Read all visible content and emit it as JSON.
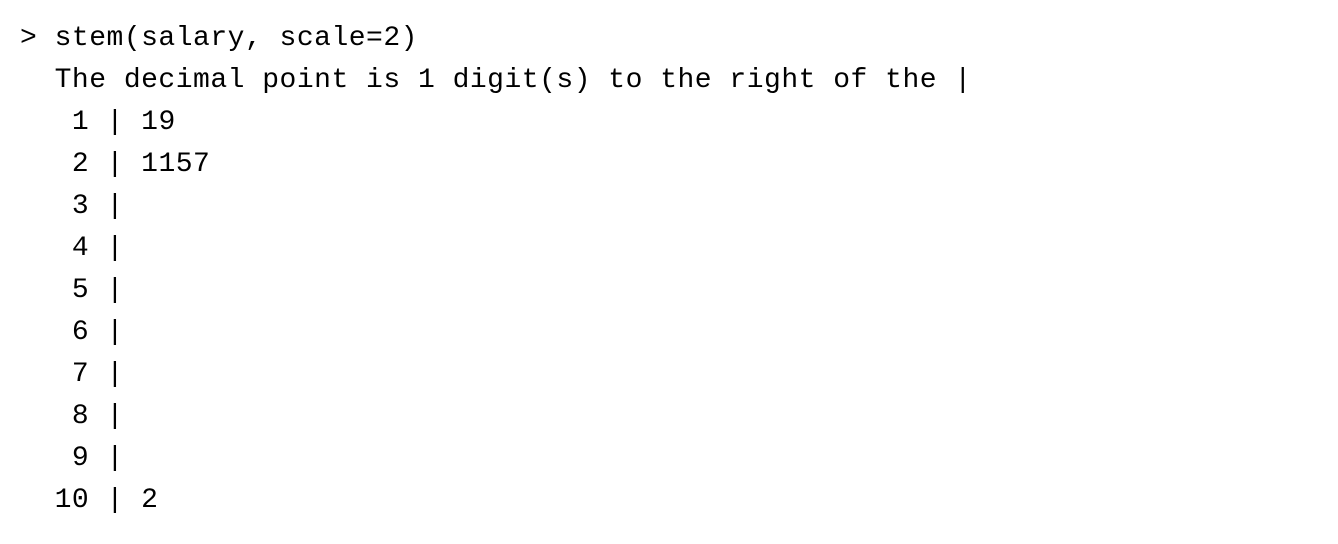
{
  "console": {
    "prompt": "> ",
    "command": "stem(salary, scale=2)",
    "info_indent": "  ",
    "info": "The decimal point is 1 digit(s) to the right of the |",
    "row_indent": "  ",
    "separator": " | ",
    "rows": [
      {
        "stem": " 1",
        "leaves": "19"
      },
      {
        "stem": " 2",
        "leaves": "1157"
      },
      {
        "stem": " 3",
        "leaves": ""
      },
      {
        "stem": " 4",
        "leaves": ""
      },
      {
        "stem": " 5",
        "leaves": ""
      },
      {
        "stem": " 6",
        "leaves": ""
      },
      {
        "stem": " 7",
        "leaves": ""
      },
      {
        "stem": " 8",
        "leaves": ""
      },
      {
        "stem": " 9",
        "leaves": ""
      },
      {
        "stem": "10",
        "leaves": "2"
      }
    ]
  },
  "chart_data": {
    "type": "table",
    "title": "Stem-and-leaf plot of salary (scale=2)",
    "note": "The decimal point is 1 digit(s) to the right of the |",
    "stems": [
      1,
      2,
      3,
      4,
      5,
      6,
      7,
      8,
      9,
      10
    ],
    "leaves": [
      "19",
      "1157",
      "",
      "",
      "",
      "",
      "",
      "",
      "",
      "2"
    ],
    "implied_values": [
      11,
      19,
      21,
      21,
      25,
      27,
      102
    ]
  }
}
